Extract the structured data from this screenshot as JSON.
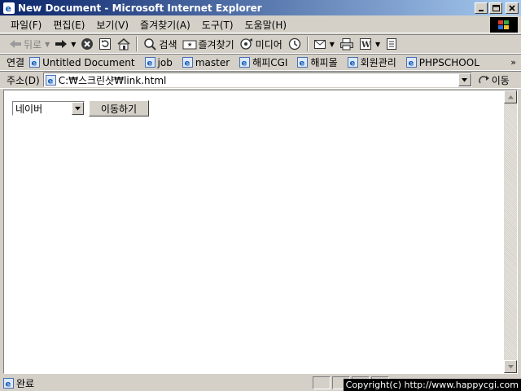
{
  "window": {
    "title": "New Document - Microsoft Internet Explorer"
  },
  "menu": {
    "items": [
      "파일(F)",
      "편집(E)",
      "보기(V)",
      "즐겨찾기(A)",
      "도구(T)",
      "도움말(H)"
    ]
  },
  "toolbar": {
    "back_label": "뒤로",
    "search_label": "검색",
    "favorites_label": "즐겨찾기",
    "media_label": "미디어"
  },
  "links": {
    "label": "연결",
    "items": [
      "Untitled Document",
      "job",
      "master",
      "해피CGI",
      "해피몰",
      "회원관리",
      "PHPSCHOOL"
    ]
  },
  "address": {
    "label": "주소(D)",
    "url": "C:₩스크린샷₩link.html",
    "go_label": "이동"
  },
  "page": {
    "select_value": "네이버",
    "button_label": "이동하기"
  },
  "status": {
    "text": "완료"
  },
  "overlay": {
    "copyright": "Copyright(c) http://www.happycgi.com"
  },
  "colors": {
    "titlebar_start": "#0a246a",
    "titlebar_end": "#a6caf0",
    "chrome": "#d4d0c8"
  }
}
